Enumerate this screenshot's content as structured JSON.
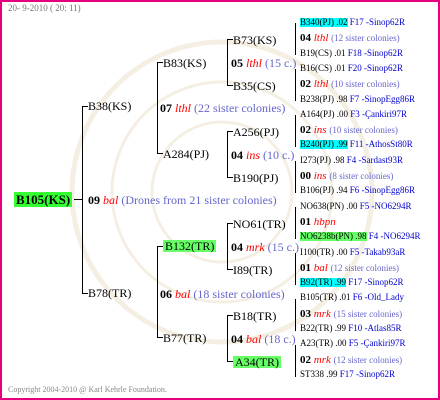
{
  "header": {
    "date": "20-  9-2010 ( 20: 11)"
  },
  "footer": {
    "copyright": "Copyright 2004-2010 @ Karl Kehrle Foundation."
  },
  "root": {
    "id": "B105(KS)",
    "gen_num": "09",
    "gen_race": "bal",
    "gen_note": "(Drones from 21 sister colonies)"
  },
  "p1": {
    "id": "B38(KS)",
    "gen_num": "07",
    "gen_race": "lthl",
    "gen_note": "(22 sister colonies)"
  },
  "p2": {
    "id": "B78(TR)",
    "gen_num": "06",
    "gen_race": "bal",
    "gen_note": "(18 sister colonies)"
  },
  "g1": {
    "id": "B83(KS)",
    "gen_num": "05",
    "gen_race": "lthl",
    "gen_note": "(15 c.)"
  },
  "g2": {
    "id": "A284(PJ)",
    "gen_num": "04",
    "gen_race": "ins",
    "gen_note": "(10 c.)"
  },
  "g3": {
    "id": "B132(TR)",
    "gen_num": "04",
    "gen_race": "mrk",
    "gen_note": "(15 c.)"
  },
  "g4": {
    "id": "B77(TR)",
    "gen_num": "04",
    "gen_race": "bal",
    "gen_note": "(18 c.)"
  },
  "gg": [
    {
      "id": "B73(KS)"
    },
    {
      "id": "B35(CS)"
    },
    {
      "id": "A256(PJ)"
    },
    {
      "id": "B190(PJ)"
    },
    {
      "id": "NO61(TR)"
    },
    {
      "id": "I89(TR)"
    },
    {
      "id": "B18(TR)"
    },
    {
      "id": "A34(TR)"
    }
  ],
  "leaves": [
    {
      "pid": "B340(PJ) .02",
      "src": "F17 -Sinop62R",
      "cyan": true
    },
    {
      "num": "04",
      "race": "lthl",
      "note": "(12 sister colonies)"
    },
    {
      "pid": "B19(CS) .01",
      "src": "F18 -Sinop62R"
    },
    {
      "pid": "B16(CS) .01",
      "src": "F20 -Sinop62R"
    },
    {
      "num": "02",
      "race": "lthl",
      "note": "(10 sister colonies)"
    },
    {
      "pid": "B238(PJ) .98",
      "src": "F7 -SinopEgg86R"
    },
    {
      "pid": "A164(PJ) .00",
      "src": "F3 -Çankiri97R"
    },
    {
      "num": "02",
      "race": "ins",
      "note": "(10 sister colonies)"
    },
    {
      "pid": "B240(PJ) .99",
      "src": "F11 -AthosSt80R",
      "cyan": true
    },
    {
      "pid": "I273(PJ) .98",
      "src": "F4 -Sardast93R"
    },
    {
      "num": "00",
      "race": "ins",
      "note": "(8 sister colonies)"
    },
    {
      "pid": "B106(PJ) .94",
      "src": "F6 -SinopEgg86R"
    },
    {
      "pid": "NO638(PN) .00",
      "src": "F5 -NO6294R"
    },
    {
      "num": "01",
      "race": "hbpn",
      "note": ""
    },
    {
      "pid": "NO6238b(PN) .98",
      "src": "F4 -NO6294R",
      "green": true
    },
    {
      "pid": "I100(TR) .00",
      "src": "F5 -Takab93aR"
    },
    {
      "num": "01",
      "race": "bal",
      "note": "(12 sister colonies)"
    },
    {
      "pid": "B92(TR) .99",
      "src": "F17 -Sinop62R",
      "cyan": true
    },
    {
      "pid": "B105(TR) .01",
      "src": "F6 -Old_Lady"
    },
    {
      "num": "03",
      "race": "mrk",
      "note": "(15 sister colonies)"
    },
    {
      "pid": "B22(TR) .99",
      "src": "F10 -Atlas85R"
    },
    {
      "pid": "A23(TR) .00",
      "src": "F5 -Çankiri97R"
    },
    {
      "num": "02",
      "race": "mrk",
      "note": "(12 sister colonies)"
    },
    {
      "pid": "ST338 .99",
      "src": "F17 -Sinop62R"
    }
  ]
}
